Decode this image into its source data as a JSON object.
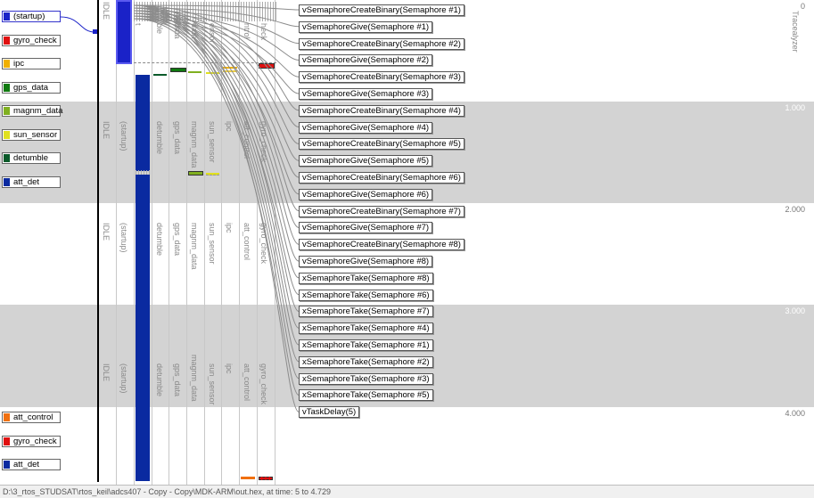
{
  "legend_top": [
    {
      "label": "(startup)",
      "color": "#1a22c8",
      "selected": true
    },
    {
      "label": "gyro_check",
      "color": "#e01010"
    },
    {
      "label": "ipc",
      "color": "#f0b000"
    },
    {
      "label": "gps_data",
      "color": "#107a10"
    },
    {
      "label": "magnm_data",
      "color": "#80b020"
    },
    {
      "label": "sun_sensor",
      "color": "#e0e020"
    },
    {
      "label": "detumble",
      "color": "#0a5a2a"
    },
    {
      "label": "att_det",
      "color": "#0a2aa0"
    }
  ],
  "legend_bottom": [
    {
      "label": "att_control",
      "color": "#f07010"
    },
    {
      "label": "gyro_check",
      "color": "#e01010"
    },
    {
      "label": "att_det",
      "color": "#0a2aa0"
    }
  ],
  "column_labels": {
    "row1": [
      "IDLE",
      "(startup)",
      "detumble",
      "gps_data",
      "magnm_data",
      "sun_sensor",
      "ipc",
      "att_control",
      "gyro_check"
    ],
    "row2": [
      "IDLE",
      "(startup)",
      "detumble",
      "gps_data",
      "magnm_data",
      "sun_sensor",
      "ipc",
      "att_control",
      "gyro_check"
    ],
    "row3": [
      "IDLE",
      "(startup)",
      "detumble",
      "gps_data",
      "magnm_data",
      "sun_sensor",
      "ipc",
      "att_control",
      "gyro_check"
    ],
    "top_partial": [
      "IDLE",
      "t",
      "ble",
      "data",
      "data",
      "ensor",
      "",
      "ntrol",
      "heck"
    ]
  },
  "time_ticks": [
    "0",
    "1.000",
    "2.000",
    "3.000",
    "4.000"
  ],
  "vertical_title": "Tracealyzer",
  "events": [
    "vSemaphoreCreateBinary(Semaphore #1)",
    "vSemaphoreGive(Semaphore #1)",
    "vSemaphoreCreateBinary(Semaphore #2)",
    "vSemaphoreGive(Semaphore #2)",
    "vSemaphoreCreateBinary(Semaphore #3)",
    "vSemaphoreGive(Semaphore #3)",
    "vSemaphoreCreateBinary(Semaphore #4)",
    "vSemaphoreGive(Semaphore #4)",
    "vSemaphoreCreateBinary(Semaphore #5)",
    "vSemaphoreGive(Semaphore #5)",
    "vSemaphoreCreateBinary(Semaphore #6)",
    "vSemaphoreGive(Semaphore #6)",
    "vSemaphoreCreateBinary(Semaphore #7)",
    "vSemaphoreGive(Semaphore #7)",
    "vSemaphoreCreateBinary(Semaphore #8)",
    "vSemaphoreGive(Semaphore #8)",
    "xSemaphoreTake(Semaphore #8)",
    "xSemaphoreTake(Semaphore #6)",
    "xSemaphoreTake(Semaphore #7)",
    "xSemaphoreTake(Semaphore #4)",
    "xSemaphoreTake(Semaphore #1)",
    "xSemaphoreTake(Semaphore #2)",
    "xSemaphoreTake(Semaphore #3)",
    "xSemaphoreTake(Semaphore #5)",
    "vTaskDelay(5)"
  ],
  "status_text": "D:\\3_rtos_STUDSAT\\rtos_keil\\adcs407 - Copy - Copy\\MDK-ARM\\out.hex, at time: 5 to 4.729"
}
